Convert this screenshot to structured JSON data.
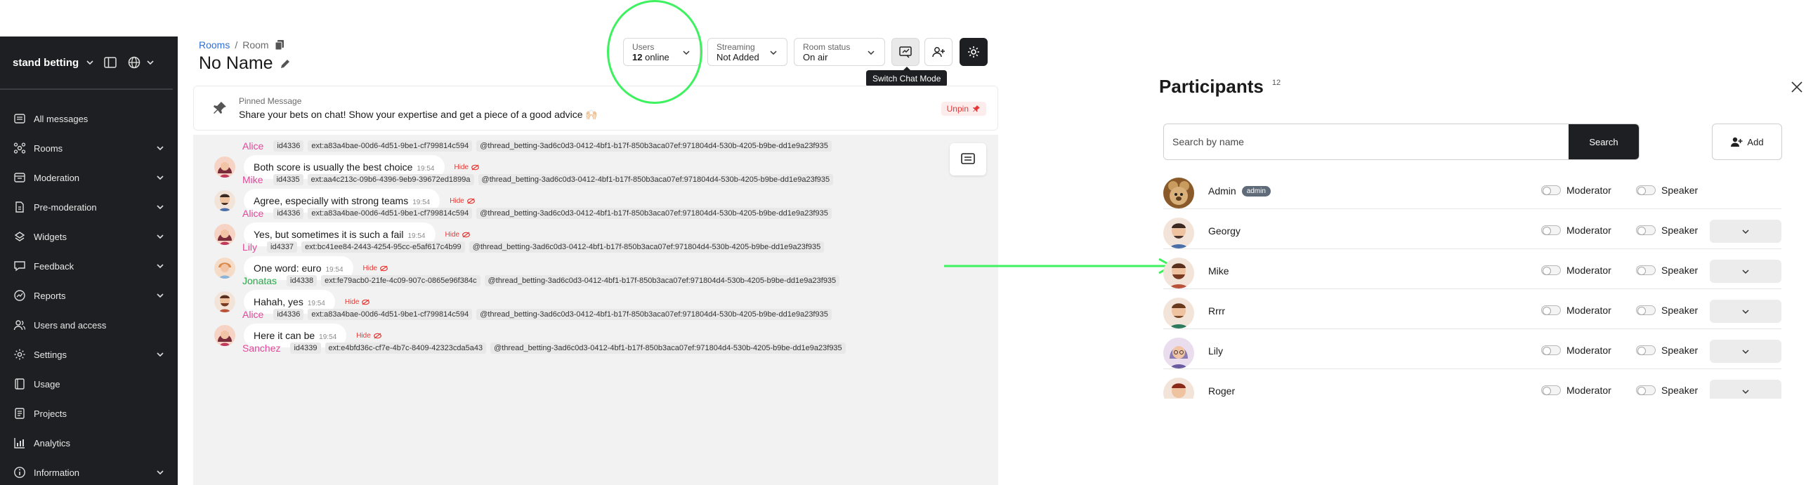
{
  "sidebar": {
    "project": "stand betting",
    "items": [
      {
        "label": "All messages",
        "icon": "list-icon",
        "chevron": false
      },
      {
        "label": "Rooms",
        "icon": "rooms-icon",
        "chevron": true
      },
      {
        "label": "Moderation",
        "icon": "moderation-icon",
        "chevron": true
      },
      {
        "label": "Pre-moderation",
        "icon": "pre-moderation-icon",
        "chevron": true
      },
      {
        "label": "Widgets",
        "icon": "widgets-icon",
        "chevron": true
      },
      {
        "label": "Feedback",
        "icon": "feedback-icon",
        "chevron": true
      },
      {
        "label": "Reports",
        "icon": "reports-icon",
        "chevron": true
      },
      {
        "label": "Users and access",
        "icon": "users-icon",
        "chevron": false
      },
      {
        "label": "Settings",
        "icon": "gear-icon",
        "chevron": true
      },
      {
        "label": "Usage",
        "icon": "usage-icon",
        "chevron": false
      },
      {
        "label": "Projects",
        "icon": "projects-icon",
        "chevron": false
      },
      {
        "label": "Analytics",
        "icon": "analytics-icon",
        "chevron": false
      },
      {
        "label": "Information",
        "icon": "info-icon",
        "chevron": true
      }
    ]
  },
  "header": {
    "breadcrumb_rooms": "Rooms",
    "breadcrumb_sep": "/",
    "breadcrumb_room": "Room",
    "title": "No Name",
    "users_label": "Users",
    "users_count": "12",
    "users_suffix": "online",
    "streaming_label": "Streaming",
    "streaming_value": "Not Added",
    "room_status_label": "Room status",
    "room_status_value": "On air",
    "tooltip": "Switch Chat Mode"
  },
  "pinned": {
    "label": "Pinned Message",
    "text": "Share your bets on chat! Show your expertise and get a piece of a good advice 🙌🏻",
    "unpin": "Unpin"
  },
  "messages": [
    {
      "author": "Alice",
      "color": "#e0499a",
      "id": "id4336",
      "ext": "ext:a83a4bae-00d6-4d51-9be1-cf799814c594",
      "thread": "@thread_betting-3ad6c0d3-0412-4bf1-b17f-850b3aca07ef:971804d4-530b-4205-b9be-dd1e9a23f935",
      "text": "Both score is usually the best choice",
      "time": "19:54",
      "hide": "Hide"
    },
    {
      "author": "Mike",
      "color": "#e0499a",
      "id": "id4335",
      "ext": "ext:aa4c213c-09b6-4396-9eb9-39672ed1899a",
      "thread": "@thread_betting-3ad6c0d3-0412-4bf1-b17f-850b3aca07ef:971804d4-530b-4205-b9be-dd1e9a23f935",
      "text": "Agree, especially with strong teams",
      "time": "19:54",
      "hide": "Hide"
    },
    {
      "author": "Alice",
      "color": "#e0499a",
      "id": "id4336",
      "ext": "ext:a83a4bae-00d6-4d51-9be1-cf799814c594",
      "thread": "@thread_betting-3ad6c0d3-0412-4bf1-b17f-850b3aca07ef:971804d4-530b-4205-b9be-dd1e9a23f935",
      "text": "Yes, but sometimes it is such a fail",
      "time": "19:54",
      "hide": "Hide"
    },
    {
      "author": "Lily",
      "color": "#e0499a",
      "id": "id4337",
      "ext": "ext:bc41ee84-2443-4254-95cc-e5af617c4b99",
      "thread": "@thread_betting-3ad6c0d3-0412-4bf1-b17f-850b3aca07ef:971804d4-530b-4205-b9be-dd1e9a23f935",
      "text": "One word: euro",
      "time": "19:54",
      "hide": "Hide"
    },
    {
      "author": "Jonatas",
      "color": "#2aa84a",
      "id": "id4338",
      "ext": "ext:fe79acb0-21fe-4c09-907c-0865e96f384c",
      "thread": "@thread_betting-3ad6c0d3-0412-4bf1-b17f-850b3aca07ef:971804d4-530b-4205-b9be-dd1e9a23f935",
      "text": "Hahah, yes",
      "time": "19:54",
      "hide": "Hide"
    },
    {
      "author": "Alice",
      "color": "#e0499a",
      "id": "id4336",
      "ext": "ext:a83a4bae-00d6-4d51-9be1-cf799814c594",
      "thread": "@thread_betting-3ad6c0d3-0412-4bf1-b17f-850b3aca07ef:971804d4-530b-4205-b9be-dd1e9a23f935",
      "text": "Here it can be",
      "time": "19:54",
      "hide": "Hide"
    },
    {
      "author": "Sanchez",
      "color": "#e0499a",
      "id": "id4339",
      "ext": "ext:e4bfd36c-cf7e-4b7c-8409-42323cda5a43",
      "thread": "@thread_betting-3ad6c0d3-0412-4bf1-b17f-850b3aca07ef:971804d4-530b-4205-b9be-dd1e9a23f935",
      "text": "",
      "time": "",
      "hide": ""
    }
  ],
  "participants_panel": {
    "title": "Participants",
    "count": "12",
    "search_placeholder": "Search by name",
    "search_button": "Search",
    "add_button": "Add",
    "moderator_label": "Moderator",
    "speaker_label": "Speaker",
    "participants": [
      {
        "name": "Admin",
        "badge": "admin",
        "dropdown": false
      },
      {
        "name": "Georgy",
        "badge": "",
        "dropdown": true
      },
      {
        "name": "Mike",
        "badge": "",
        "dropdown": true
      },
      {
        "name": "Rrrr",
        "badge": "",
        "dropdown": true
      },
      {
        "name": "Lily",
        "badge": "",
        "dropdown": true
      },
      {
        "name": "Roger",
        "badge": "",
        "dropdown": true
      }
    ]
  },
  "colors": {
    "sidebar_bg": "#1e1f22",
    "accent_link": "#2f6fd8",
    "danger": "#e53935",
    "highlight": "#3df25e"
  }
}
